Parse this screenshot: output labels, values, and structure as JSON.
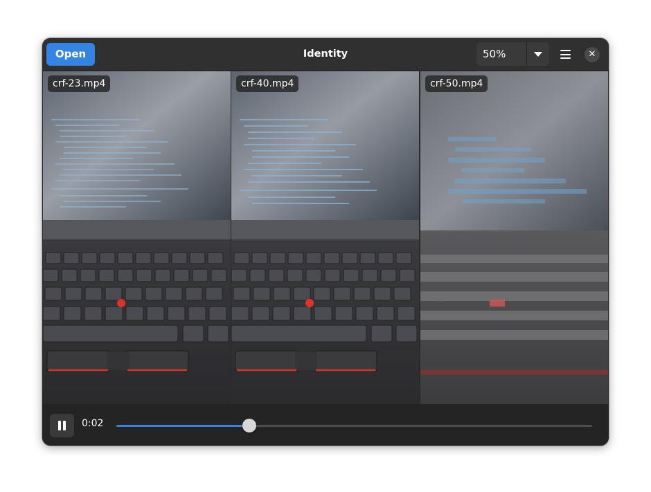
{
  "window": {
    "title": "Identity"
  },
  "header": {
    "open_label": "Open",
    "zoom": {
      "value": "50%",
      "icon": "chevron-down-icon"
    },
    "menu_icon": "hamburger-menu-icon",
    "close_icon": "close-icon"
  },
  "videos": [
    {
      "label": "crf-23.mp4"
    },
    {
      "label": "crf-40.mp4"
    },
    {
      "label": "crf-50.mp4"
    }
  ],
  "controls": {
    "play_state_icon": "pause-icon",
    "time": "0:02",
    "progress": 0.28
  },
  "colors": {
    "accent": "#3584e4",
    "window_bg": "#242424",
    "header_bg": "#303030"
  }
}
